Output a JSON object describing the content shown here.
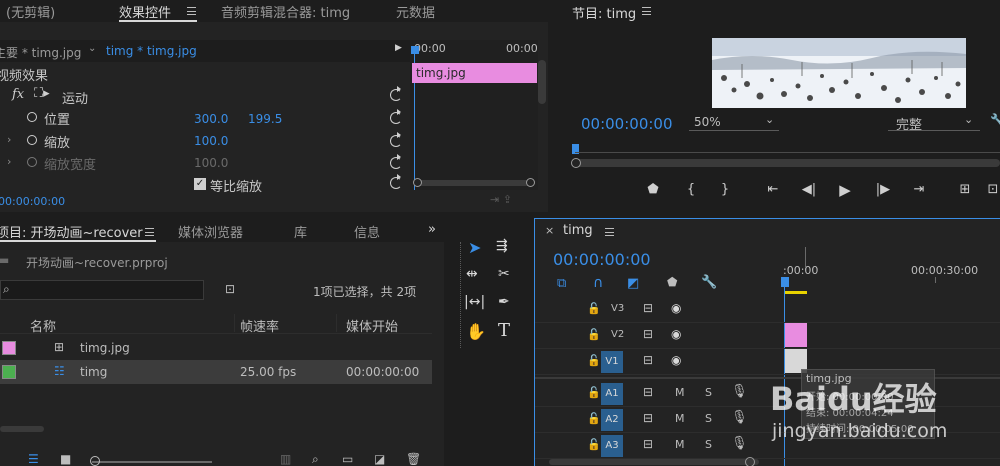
{
  "source_panel": {
    "tabs": [
      {
        "label": "源：(无剪辑)"
      },
      {
        "label": "效果控件"
      },
      {
        "label": "音频剪辑混合器: timg"
      },
      {
        "label": "元数据"
      }
    ],
    "header": {
      "master": "主要 * timg.jpg",
      "clip": "timg * timg.jpg"
    },
    "ruler": {
      "start": "00:00",
      "end": "00:00"
    },
    "clip_bar_label": "timg.jpg",
    "video_effects_label": "视频效果",
    "fx_symbol": "fx",
    "motion_label": "运动",
    "properties": [
      {
        "name": "位置",
        "values": [
          "300.0",
          "199.5"
        ]
      },
      {
        "name": "缩放",
        "values": [
          "100.0"
        ]
      },
      {
        "name": "缩放宽度",
        "values": [
          "100.0"
        ]
      }
    ],
    "uniform_scale": "等比缩放",
    "timecode": "00:00:00:00"
  },
  "program_monitor": {
    "title": "节目: timg",
    "timecode": "00:00:00:00",
    "zoom": "50%",
    "quality": "完整"
  },
  "project_panel": {
    "tabs": [
      {
        "label": "项目: 开场动画~recover"
      },
      {
        "label": "媒体浏览器"
      },
      {
        "label": "库"
      },
      {
        "label": "信息"
      }
    ],
    "file_name": "开场动画~recover.prproj",
    "selection_status": "1项已选择，共 2项",
    "columns": [
      "名称",
      "帧速率",
      "媒体开始"
    ],
    "items": [
      {
        "name": "timg.jpg",
        "color": "#e88ce0",
        "fps": "",
        "start": ""
      },
      {
        "name": "timg",
        "color": "#4caf50",
        "fps": "25.00 fps",
        "start": "00:00:00:00"
      }
    ]
  },
  "timeline_panel": {
    "sequence_tab": "timg",
    "timecode": "00:00:00:00",
    "ruler": {
      "start": ":00:00",
      "mark": "00:00:30:00"
    },
    "video_tracks": [
      "V3",
      "V2",
      "V1"
    ],
    "audio_tracks": [
      "A1",
      "A2",
      "A3"
    ],
    "audio_buttons": {
      "mute": "M",
      "solo": "S"
    },
    "tooltip": {
      "name": "timg.jpg",
      "line1": "开始: 00:00:00:00",
      "line2": "结束: 00:00:04:24",
      "line3": "持续时间: 00:00:05:00"
    }
  },
  "watermark": {
    "brand": "Baidu经验",
    "url": "jingyan.baidu.com"
  },
  "colors": {
    "accent": "#3a8ee6",
    "pink": "#e88ce0",
    "green": "#4caf50",
    "panel": "#232323",
    "bg": "#1d1d1d"
  }
}
